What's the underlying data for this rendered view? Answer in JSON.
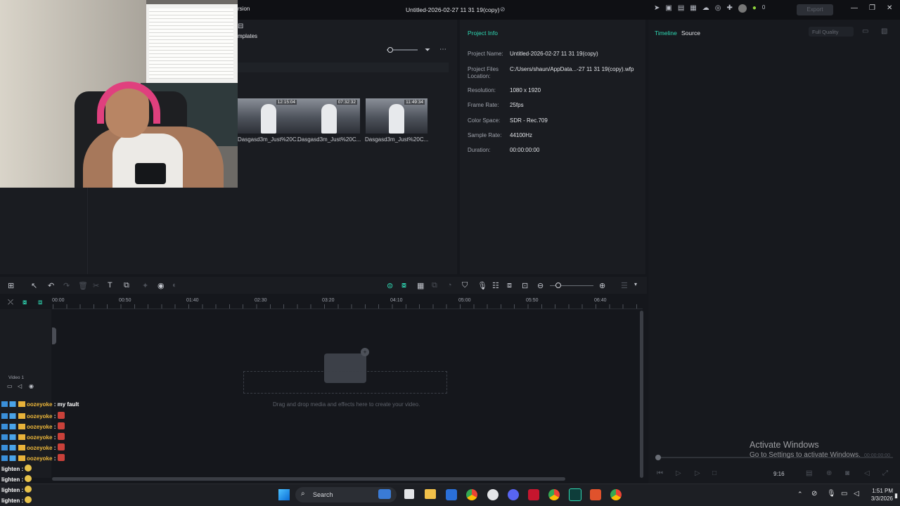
{
  "titlebar": {
    "left_text": "rsion",
    "project_title": "Untitled-2026-02-27 11 31 19(copy)",
    "credits": "0",
    "export_label": "Export"
  },
  "media": {
    "tab_templates": "mplates",
    "thumbnails": [
      {
        "duration": "12:15:04",
        "label": "Dasgasd3m_Just%20C..."
      },
      {
        "duration": "07:32:32",
        "label": "Dasgasd3m_Just%20C..."
      },
      {
        "duration": "11:49:34",
        "label": "Dasgasd3m_Just%20C..."
      }
    ]
  },
  "project_info": {
    "title": "Project Info",
    "rows": [
      {
        "label": "Project Name:",
        "value": "Untitled-2026-02-27 11 31 19(copy)"
      },
      {
        "label": "Project Files Location:",
        "value": "C:/Users/shaun/AppData...-27 11 31 19(copy).wfp"
      },
      {
        "label": "Resolution:",
        "value": "1080 x 1920"
      },
      {
        "label": "Frame Rate:",
        "value": "25fps"
      },
      {
        "label": "Color Space:",
        "value": "SDR - Rec.709"
      },
      {
        "label": "Sample Rate:",
        "value": "44100Hz"
      },
      {
        "label": "Duration:",
        "value": "00:00:00:00"
      }
    ]
  },
  "player": {
    "tab_timeline": "Timeline",
    "tab_source": "Source",
    "quality": "Full Quality",
    "aspect": "9:16",
    "timecode": "00:00:00:00"
  },
  "timeline": {
    "ticks": [
      "00:00",
      "00:50",
      "01:40",
      "02:30",
      "03:20",
      "04:10",
      "05:00",
      "05:50",
      "06:40"
    ],
    "track_name": "Video 1",
    "drop_hint": "Drag and drop media and effects here to create your video."
  },
  "watermark": {
    "line1": "Activate Windows",
    "line2": "Go to Settings to activate Windows."
  },
  "chat": [
    {
      "user": "oozeyoke",
      "text": ": my fault"
    },
    {
      "user": "oozeyoke",
      "text": ":"
    },
    {
      "user": "oozeyoke",
      "text": ":"
    },
    {
      "user": "oozeyoke",
      "text": ":"
    },
    {
      "user": "oozeyoke",
      "text": ":"
    },
    {
      "user": "oozeyoke",
      "text": ":"
    },
    {
      "user": "lighten",
      "text": ":"
    },
    {
      "user": "lighten",
      "text": ":"
    },
    {
      "user": "lighten",
      "text": ":"
    },
    {
      "user": "lighten",
      "text": ":"
    }
  ],
  "taskbar": {
    "search_label": "Search",
    "time": "1:51 PM",
    "date": "3/3/2026"
  }
}
